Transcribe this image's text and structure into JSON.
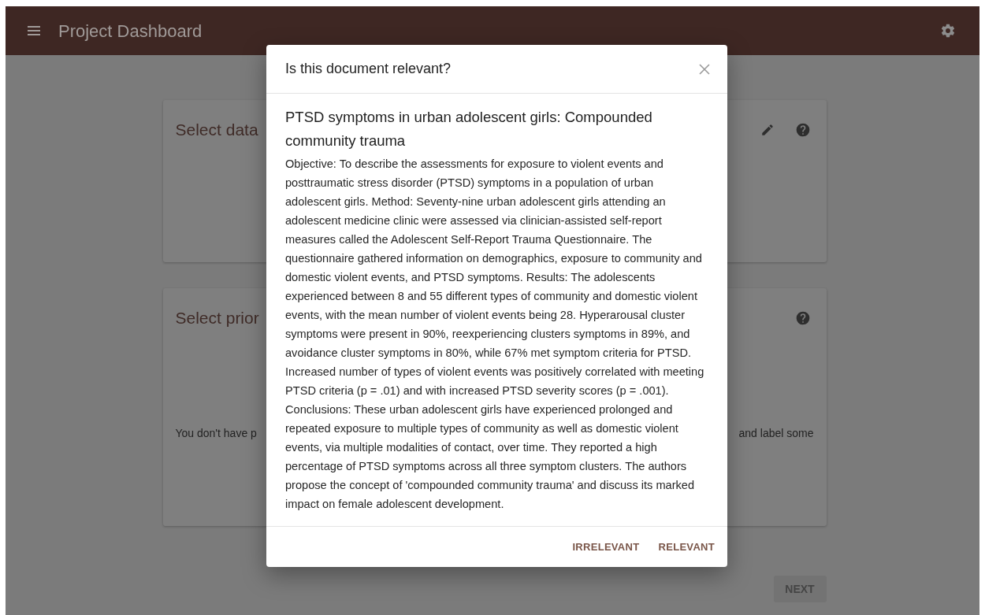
{
  "app_bar": {
    "title": "Project Dashboard"
  },
  "cards": [
    {
      "heading": "Select data",
      "editable": true
    },
    {
      "heading": "Select prior",
      "editable": false,
      "text_left": "You don't have p",
      "text_right": "and label some"
    }
  ],
  "next_button": {
    "label": "NEXT",
    "disabled": true
  },
  "dialog": {
    "title": "Is this document relevant?",
    "document_title": "PTSD symptoms in urban adolescent girls: Compounded community trauma",
    "abstract": "Objective: To describe the assessments for exposure to violent events and posttraumatic stress disorder (PTSD) symptoms in a population of urban adolescent girls. Method: Seventy-nine urban adolescent girls attending an adolescent medicine clinic were assessed via clinician-assisted self-report measures called the Adolescent Self-Report Trauma Questionnaire. The questionnaire gathered information on demographics, exposure to community and domestic violent events, and PTSD symptoms. Results: The adolescents experienced between 8 and 55 different types of community and domestic violent events, with the mean number of violent events being 28. Hyperarousal cluster symptoms were present in 90%, reexperiencing clusters symptoms in 89%, and avoidance cluster symptoms in 80%, while 67% met symptom criteria for PTSD. Increased number of types of violent events was positively correlated with meeting PTSD criteria (p = .01) and with increased PTSD severity scores (p = .001). Conclusions: These urban adolescent girls have experienced prolonged and repeated exposure to multiple types of community as well as domestic violent events, via multiple modalities of contact, over time. They reported a high percentage of PTSD symptoms across all three symptom clusters. The authors propose the concept of 'compounded community trauma' and discuss its marked impact on female adolescent development.",
    "actions": [
      {
        "label": "IRRELEVANT"
      },
      {
        "label": "RELEVANT"
      }
    ]
  }
}
